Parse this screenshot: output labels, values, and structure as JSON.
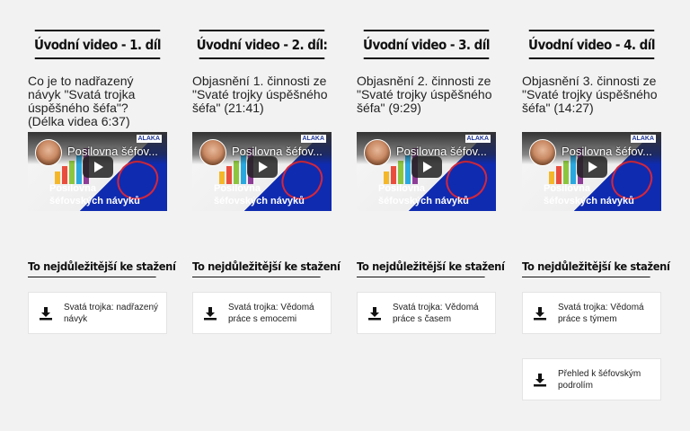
{
  "video_banner": [
    "Posilovna",
    "šéfovských návyků"
  ],
  "video_brand": "ALAKA",
  "columns": [
    {
      "title": "Úvodní video - 1. díl",
      "description": "Co je to nadřazený návyk \"Svatá trojka úspěšného šéfa\"? (Délka videa 6:37)",
      "video_title": "Posilovna šéfov...",
      "downloads_heading": "To nejdůležitější ke stažení",
      "downloads": [
        "Svatá trojka: nadřazený návyk"
      ]
    },
    {
      "title": "Úvodní video - 2. díl:",
      "description": "Objasnění 1. činnosti ze \"Svaté trojky úspěšného šéfa\" (21:41)",
      "video_title": "Posilovna šéfov...",
      "downloads_heading": "To nejdůležitější ke stažení",
      "downloads": [
        "Svatá trojka: Vědomá práce s emocemi"
      ]
    },
    {
      "title": "Úvodní video - 3. díl",
      "description": "Objasnění 2. činnosti ze \"Svaté trojky úspěšného šéfa\" (9:29)",
      "video_title": "Posilovna šéfov...",
      "downloads_heading": "To nejdůležitější ke stažení",
      "downloads": [
        "Svatá trojka: Vědomá práce s časem"
      ]
    },
    {
      "title": "Úvodní video - 4. díl",
      "description": "Objasnění 3. činnosti ze \"Svaté trojky úspěšného šéfa\" (14:27)",
      "video_title": "Posilovna šéfov...",
      "downloads_heading": "To nejdůležitější ke stažení",
      "downloads": [
        "Svatá trojka: Vědomá práce s týmem",
        "Přehled k šéfovským podrolím"
      ]
    }
  ]
}
